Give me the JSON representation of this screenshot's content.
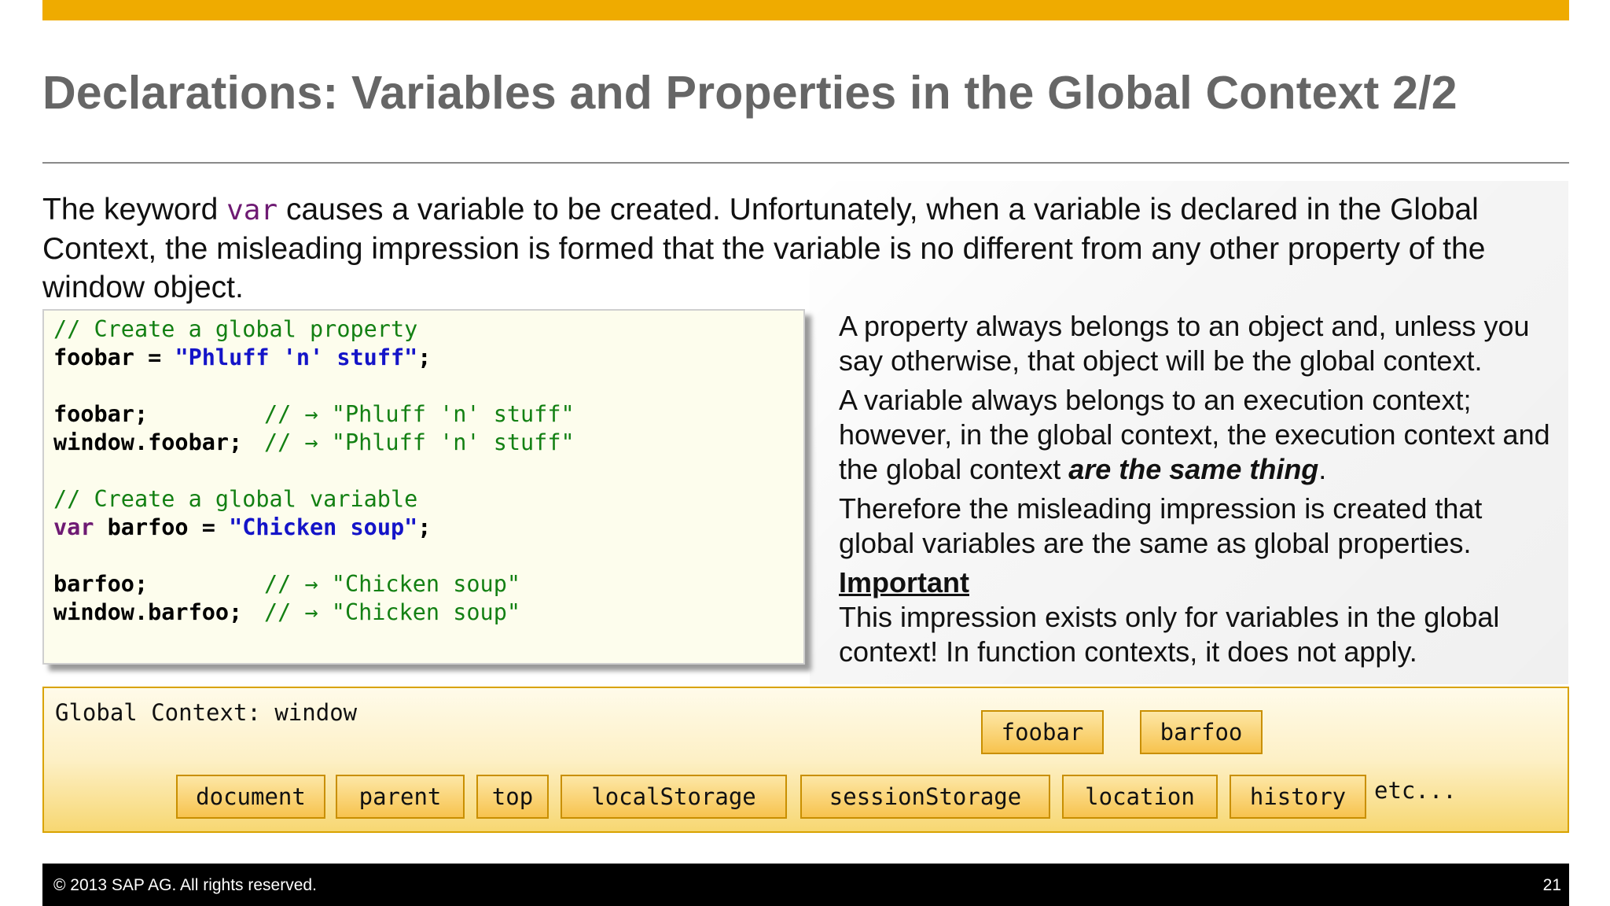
{
  "slide": {
    "title": "Declarations: Variables and Properties in the Global Context 2/2",
    "intro": {
      "line1_before": "The keyword ",
      "line1_keyword": "var",
      "line1_after": " causes a variable to be created.  Unfortunately, when a variable is declared in the Global",
      "line2": "Context, the misleading impression is formed that the variable is no different from any other property of the",
      "line3": "window object."
    },
    "code": {
      "l1_comment": "// Create a global property",
      "l2_ident": "foobar = ",
      "l2_string": "\"Phluff 'n' stuff\"",
      "l2_end": ";",
      "l4_ident": "foobar;",
      "l4_comment": "// → ",
      "l4_result": "\"Phluff 'n' stuff\"",
      "l5_ident": "window.foobar;",
      "l5_comment": "// → ",
      "l5_result": "\"Phluff 'n' stuff\"",
      "l7_comment": "// Create a global variable",
      "l8_keyword": "var",
      "l8_ident": " barfoo = ",
      "l8_string": "\"Chicken soup\"",
      "l8_end": ";",
      "l10_ident": "barfoo;",
      "l10_comment": "// → ",
      "l10_result": "\"Chicken soup\"",
      "l11_ident": "window.barfoo;",
      "l11_comment": "// → ",
      "l11_result": "\"Chicken soup\""
    },
    "explanation": {
      "p1_line1": "A property always belongs to an object and, unless you",
      "p1_line2": "say otherwise, that object will be the global context.",
      "p2_line1": "A variable always belongs to an execution context;",
      "p2_line2": "however, in the global context, the execution context and",
      "p2_line3_before": "the global context ",
      "p2_line3_em": "are the same thing",
      "p2_line3_after": ".",
      "p3_line1": "Therefore the misleading impression is created that",
      "p3_line2": "global variables are the same as global properties.",
      "important_heading": "Important",
      "p4_line1": "This impression exists only for variables in the global",
      "p4_line2": "context!  In function contexts, it does not apply."
    },
    "global_context": {
      "label": "Global Context: window",
      "user_properties": [
        "foobar",
        "barfoo"
      ],
      "builtin_properties": [
        "document",
        "parent",
        "top",
        "localStorage",
        "sessionStorage",
        "location",
        "history"
      ],
      "etc": "etc..."
    },
    "footer": {
      "copyright": "© 2013 SAP AG. All rights reserved.",
      "page_number": "21"
    },
    "colors": {
      "accent_bar": "#efab00",
      "title_text": "#666666",
      "code_comment": "#138013",
      "code_string": "#1414c8",
      "code_keyword": "#6e1a73",
      "property_box": "#f7c34e"
    }
  }
}
